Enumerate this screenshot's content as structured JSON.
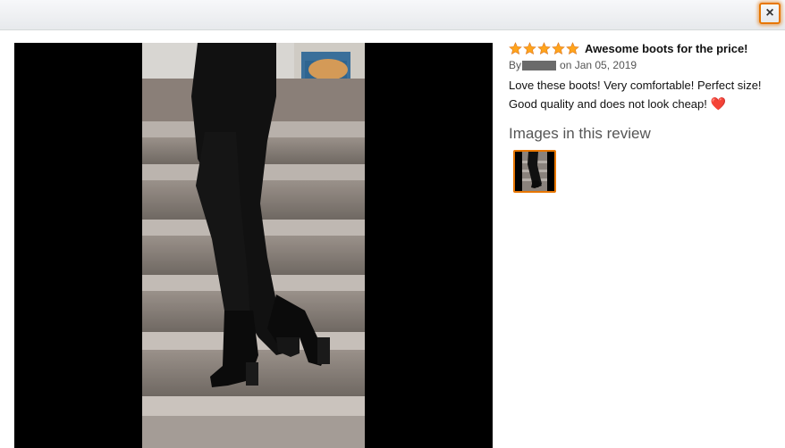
{
  "close_button": {
    "label": "×"
  },
  "review": {
    "rating": 5,
    "max_rating": 5,
    "title": "Awesome boots for the price!",
    "by_prefix": "By",
    "date": "on Jan 05, 2019",
    "body": "Love these boots! Very comfortable! Perfect size! Good quality and does not look cheap!",
    "images_heading": "Images in this review"
  },
  "colors": {
    "star": "#ffa41c",
    "accent_border": "#e77600"
  }
}
